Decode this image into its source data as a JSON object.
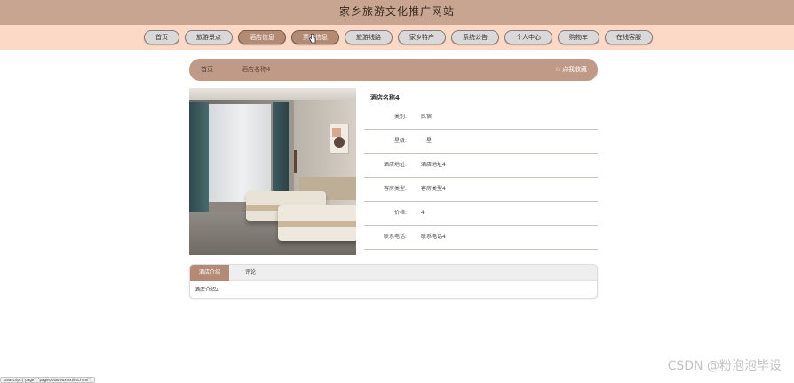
{
  "site": {
    "title": "家乡旅游文化推广网站"
  },
  "nav": {
    "items": [
      {
        "label": "首页"
      },
      {
        "label": "旅游景点"
      },
      {
        "label": "酒店信息"
      },
      {
        "label": "票务信息"
      },
      {
        "label": "旅游线路"
      },
      {
        "label": "家乡特产"
      },
      {
        "label": "系统公告"
      },
      {
        "label": "个人中心"
      },
      {
        "label": "购物车"
      },
      {
        "label": "在线客服"
      }
    ],
    "active_index": 2,
    "hover_index": 3
  },
  "breadcrumb": {
    "home": "首页",
    "current": "酒店名称4",
    "favorite_label": "点我收藏",
    "favorite_icon": "star-outline-icon"
  },
  "hotel": {
    "name": "酒店名称4",
    "fields": [
      {
        "label": "类别:",
        "value": "民宿"
      },
      {
        "label": "星级:",
        "value": "一星"
      },
      {
        "label": "酒店地址:",
        "value": "酒店地址4"
      },
      {
        "label": "客房类型:",
        "value": "客房类型4"
      },
      {
        "label": "价格:",
        "value": "4"
      },
      {
        "label": "联系电话:",
        "value": "联系电话4"
      }
    ]
  },
  "tabs": {
    "intro_label": "酒店介绍",
    "comment_label": "评论",
    "active": "intro",
    "content": "酒店介绍4"
  },
  "status_bar": {
    "url": "javascript:(\"page\", \"pages/piaowuxinxi/list.html\")"
  },
  "watermark": "CSDN @粉泡泡毕设",
  "colors": {
    "accent": "#b38a74",
    "title_bar": "#c7a590",
    "nav_bar": "#fbd9c6",
    "breadcrumb": "#c09a86"
  }
}
